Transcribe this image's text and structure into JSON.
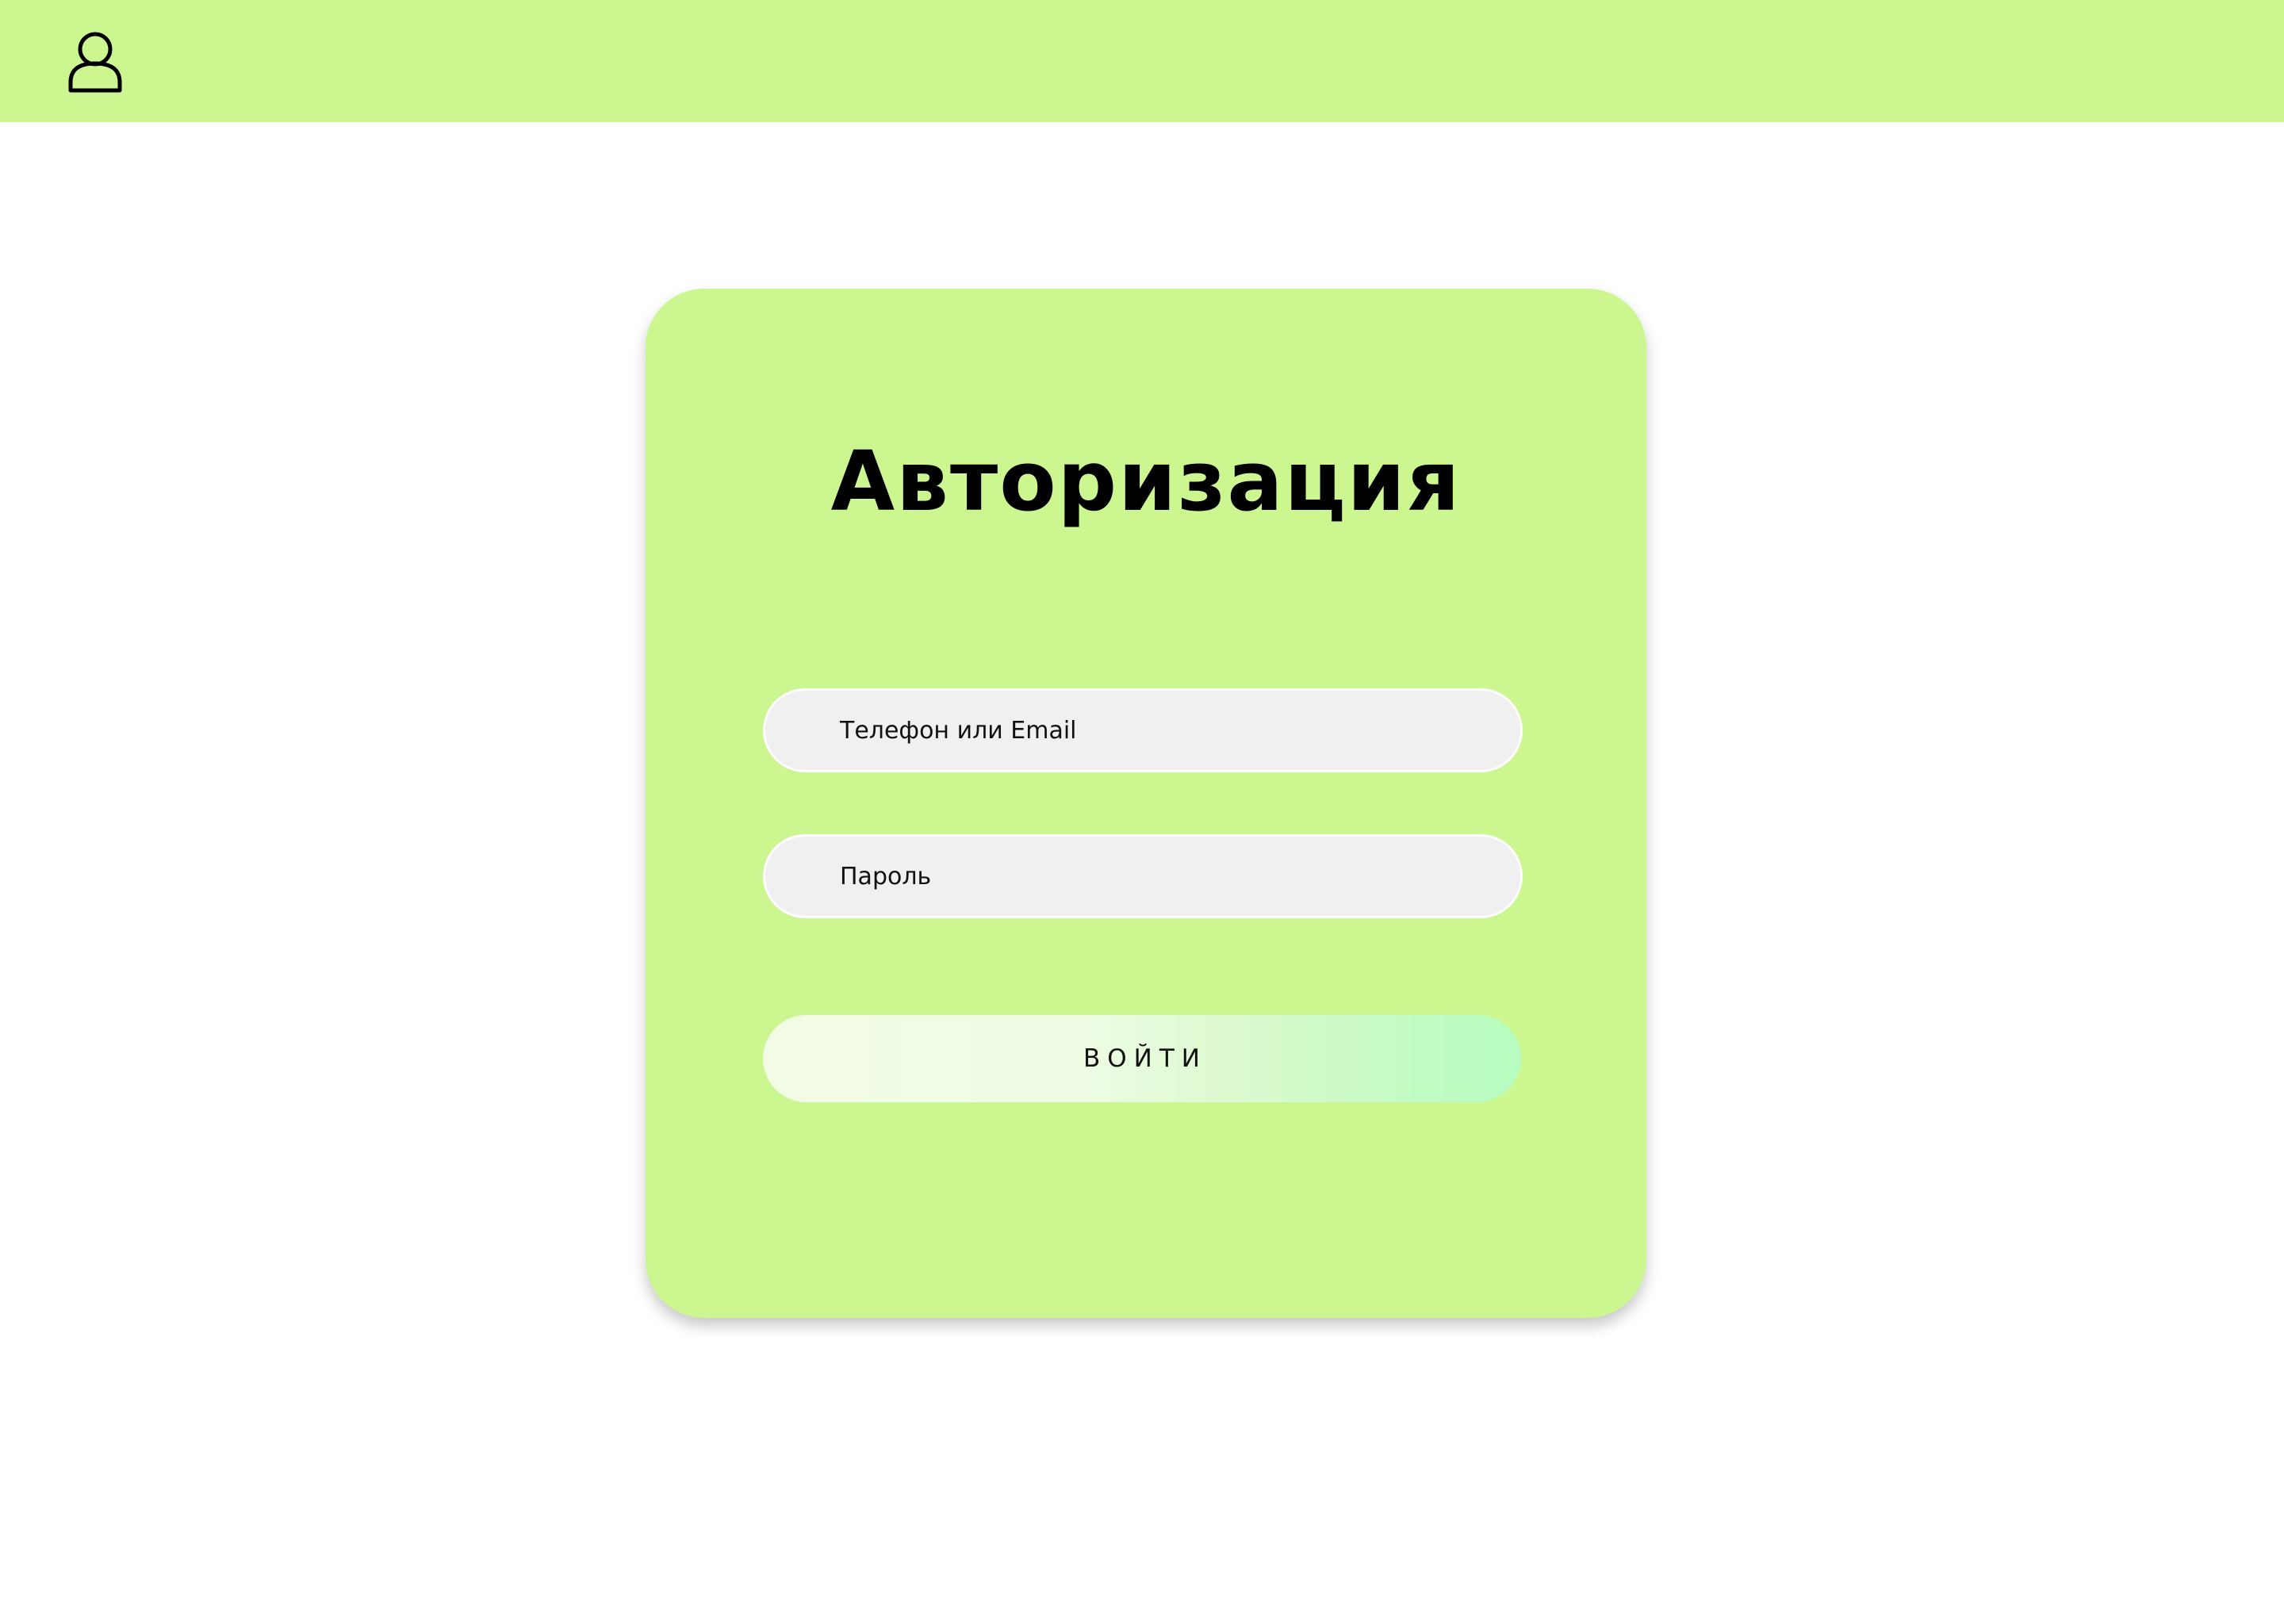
{
  "header": {
    "user_icon": "user-icon",
    "background_color": "#ccf790"
  },
  "login_card": {
    "title": "Авторизация",
    "background_color": "#ccf790",
    "phone_email_field": {
      "placeholder": "Телефон или Email",
      "value": ""
    },
    "password_field": {
      "placeholder": "Пароль",
      "value": ""
    },
    "submit_label": "ВОЙТИ"
  }
}
